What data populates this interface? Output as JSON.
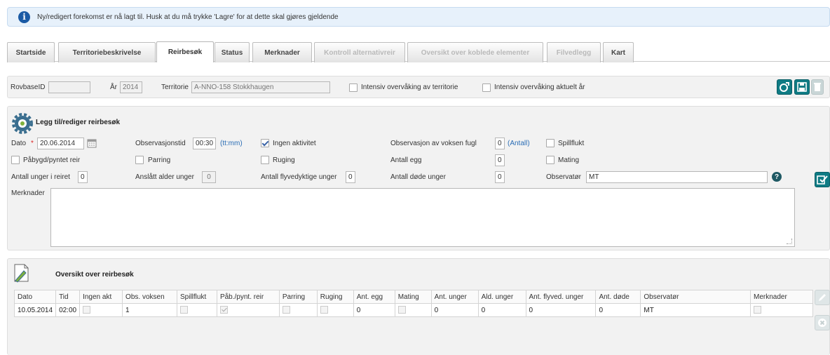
{
  "info": {
    "icon": "info-icon",
    "message": "Ny/redigert forekomst er nå lagt til. Husk at du må trykke 'Lagre' for at dette skal gjøres gjeldende"
  },
  "tabs": [
    {
      "label": "Startside",
      "state": "normal"
    },
    {
      "label": "Territoriebeskrivelse",
      "state": "normal"
    },
    {
      "label": "Reirbesøk",
      "state": "active"
    },
    {
      "label": "Status",
      "state": "normal"
    },
    {
      "label": "Merknader",
      "state": "normal"
    },
    {
      "label": "Kontroll alternativreir",
      "state": "disabled"
    },
    {
      "label": "Oversikt over koblede elementer",
      "state": "disabled"
    },
    {
      "label": "Filvedlegg",
      "state": "disabled"
    },
    {
      "label": "Kart",
      "state": "normal"
    }
  ],
  "record": {
    "rovbase_label": "RovbaseID",
    "rovbase_value": "",
    "year_label": "År",
    "year_value": "2014",
    "territory_label": "Territorie",
    "territory_value": "A-NNO-158 Stokkhaugen",
    "intensive_label": "Intensiv overvåking av territorie",
    "intensive_year_label": "Intensiv overvåking aktuelt år"
  },
  "edit": {
    "title": "Legg til/rediger reirbesøk",
    "date_label": "Dato",
    "required_mark": "*",
    "date_value": "20.06.2014",
    "obs_time_label": "Observasjonstid",
    "obs_time_value": "00:30",
    "obs_time_hint": "(tt:mm)",
    "no_activity_label": "Ingen aktivitet",
    "adult_obs_label": "Observasjon av voksen fugl",
    "adult_obs_value": "0",
    "adult_obs_hint": "(Antall)",
    "display_flight_label": "Spillflukt",
    "nest_built_label": "Påbygd/pyntet reir",
    "mating_label": "Parring",
    "incubation_label": "Ruging",
    "eggs_label": "Antall egg",
    "eggs_value": "0",
    "feeding_label": "Mating",
    "chicks_label": "Antall unger i reiret",
    "chicks_value": "0",
    "age_label": "Anslått alder unger",
    "age_value": "0",
    "fledged_label": "Antall flyvedyktige unger",
    "fledged_value": "0",
    "dead_label": "Antall døde unger",
    "dead_value": "0",
    "observer_label": "Observatør",
    "observer_value": "MT",
    "remarks_label": "Merknader",
    "remarks_value": ""
  },
  "overview": {
    "title": "Oversikt over reirbesøk",
    "columns": [
      "Dato",
      "Tid",
      "Ingen akt",
      "Obs. voksen",
      "Spillflukt",
      "Påb./pynt. reir",
      "Parring",
      "Ruging",
      "Ant. egg",
      "Mating",
      "Ant. unger",
      "Ald. unger",
      "Ant. flyved. unger",
      "Ant. døde",
      "Observatør",
      "Merknader"
    ],
    "row": {
      "dato": "10.05.2014",
      "tid": "02:00",
      "obs_voksen": "1",
      "ant_egg": "0",
      "ant_unger": "0",
      "ald_unger": "0",
      "ant_flyved": "0",
      "ant_dode": "0",
      "observator": "MT"
    }
  }
}
